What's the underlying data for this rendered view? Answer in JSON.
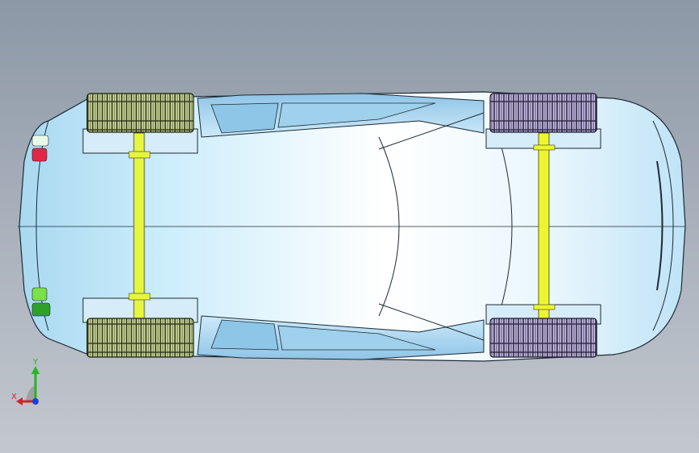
{
  "viewport": {
    "background_top": "#8c98a6",
    "background_bottom": "#c3c7ce"
  },
  "model": {
    "body_color": "#bfe3f7",
    "body_highlight": "#ffffff",
    "edge_color": "#1c2a34",
    "axle_color": "#e6f542",
    "front_tire_tint": "#c8d88a",
    "rear_tire_tint": "#b9a8d8"
  },
  "triad": {
    "x_label": "X",
    "y_label": "Y",
    "x_color": "#d42020",
    "y_color": "#27b520",
    "z_color": "#1a3fe0"
  }
}
